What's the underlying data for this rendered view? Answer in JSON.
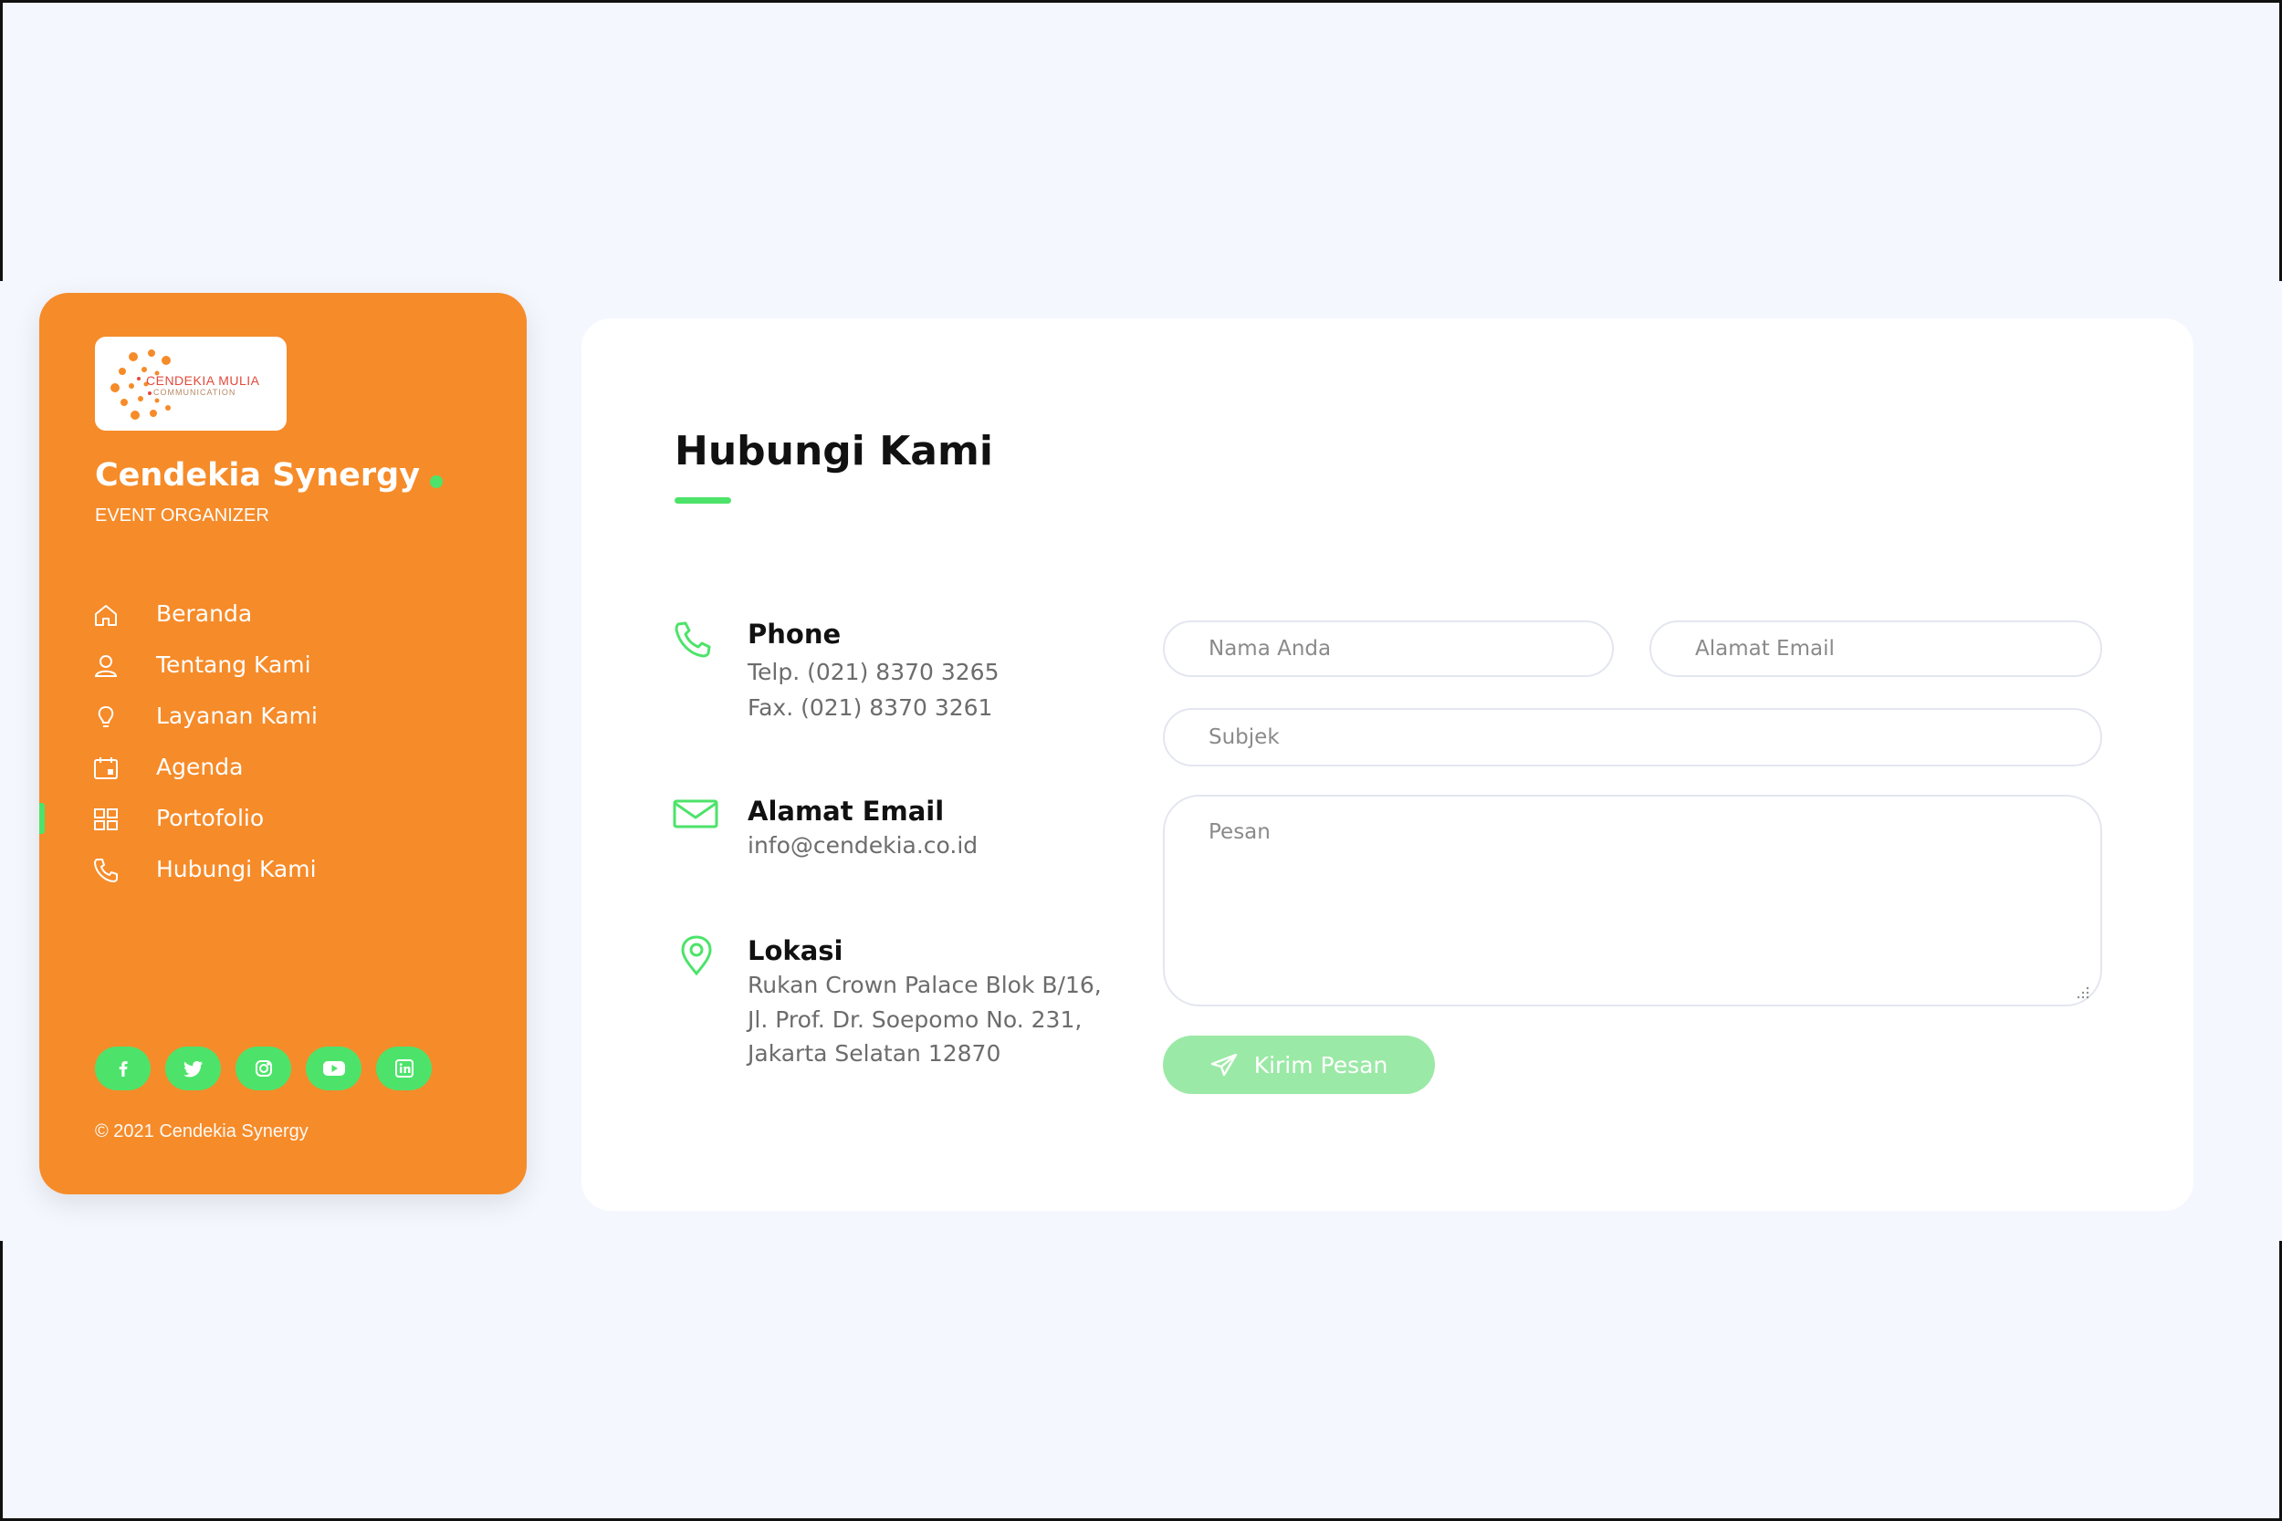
{
  "colors": {
    "page_bg": "#f5f7fe",
    "sidebar_bg": "#f68b29",
    "accent_green": "#4de36a",
    "button_green": "#9be9a6",
    "card_bg": "#ffffff"
  },
  "sidebar": {
    "logo": {
      "text_main": "CENDEKIA MULIA",
      "text_sub": "COMMUNICATION"
    },
    "brand_title": "Cendekia Synergy",
    "brand_subtitle": "EVENT ORGANIZER",
    "nav": [
      {
        "label": "Beranda",
        "icon": "home-icon"
      },
      {
        "label": "Tentang Kami",
        "icon": "user-icon"
      },
      {
        "label": "Layanan Kami",
        "icon": "lightbulb-icon"
      },
      {
        "label": "Agenda",
        "icon": "calendar-icon"
      },
      {
        "label": "Portofolio",
        "icon": "grid-icon",
        "active": true
      },
      {
        "label": "Hubungi Kami",
        "icon": "phone-icon"
      }
    ],
    "socials": [
      "facebook-icon",
      "twitter-icon",
      "instagram-icon",
      "youtube-icon",
      "linkedin-icon"
    ],
    "copyright": "© 2021 Cendekia Synergy"
  },
  "main": {
    "title": "Hubungi Kami",
    "contact": {
      "phone": {
        "heading": "Phone",
        "lines": [
          "Telp. (021) 8370 3265",
          "Fax.  (021) 8370 3261"
        ]
      },
      "email": {
        "heading": "Alamat Email",
        "lines": [
          "info@cendekia.co.id"
        ]
      },
      "location": {
        "heading": "Lokasi",
        "lines": [
          "Rukan Crown Palace Blok B/16,",
          "Jl. Prof. Dr. Soepomo No. 231,",
          "Jakarta Selatan 12870"
        ]
      }
    },
    "form": {
      "name_placeholder": "Nama Anda",
      "email_placeholder": "Alamat Email",
      "subject_placeholder": "Subjek",
      "message_placeholder": "Pesan",
      "submit_label": "Kirim Pesan"
    }
  }
}
